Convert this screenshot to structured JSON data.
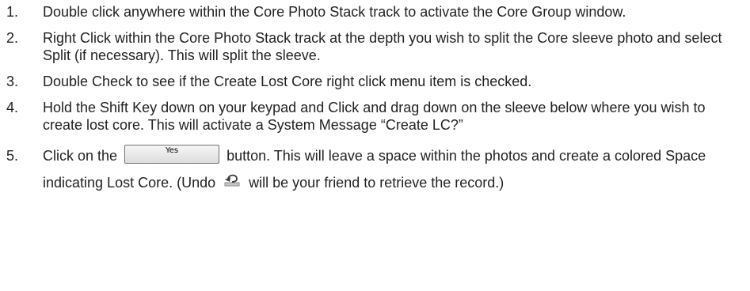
{
  "steps": [
    {
      "number": "1.",
      "text": "Double click anywhere within the Core Photo Stack track to activate the Core Group window."
    },
    {
      "number": "2.",
      "text": "Right Click within the Core Photo Stack track at the depth you wish to split the Core sleeve photo and select Split (if necessary). This will split the sleeve."
    },
    {
      "number": "3.",
      "text": "Double Check to see if the Create Lost Core right click menu item is checked."
    },
    {
      "number": "4.",
      "text": "Hold the Shift Key down on your keypad and Click and drag down on the sleeve below where you wish to create lost core. This will activate a System Message “Create LC?”"
    },
    {
      "number": "5.",
      "text_before_button": "Click on the",
      "button_label": "Yes",
      "text_after_button": "button. This will leave a space within the photos and create a colored Space indicating Lost Core. (Undo",
      "undo_icon": "undo-icon",
      "text_after_icon": "will be your friend to retrieve the record.)"
    }
  ]
}
